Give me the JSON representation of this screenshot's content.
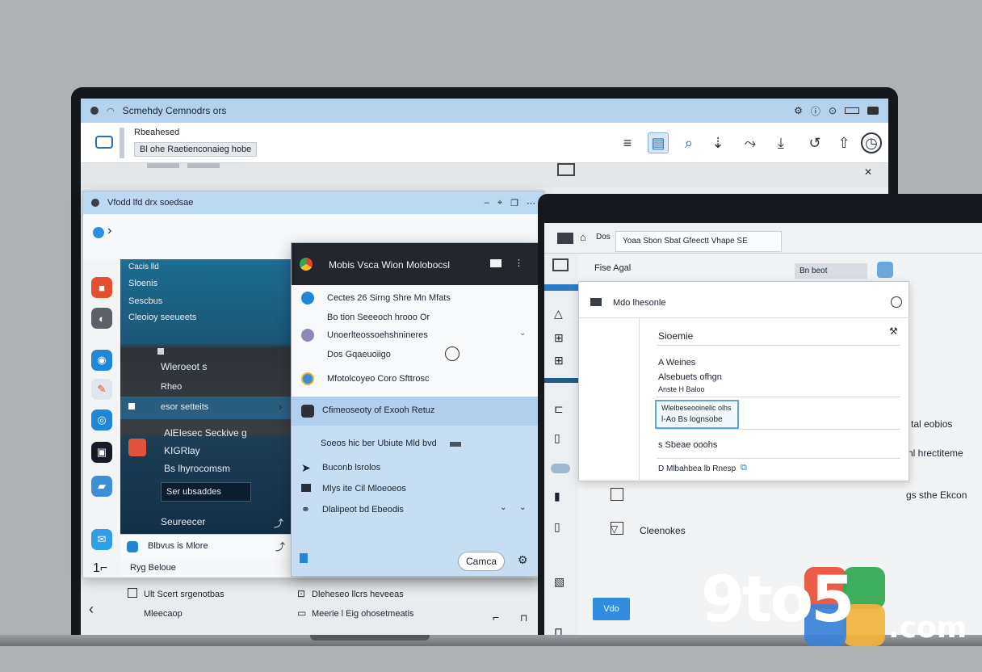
{
  "top_window": {
    "title": "Scmehdy Cemnodrs ors",
    "breadcrumb_top": "Rbeahesed",
    "breadcrumb_bottom": "Bl ohe Raetienconaieg hobe"
  },
  "left_window": {
    "title": "Vfodd lfd drx soedsae",
    "dark_pane": {
      "header": "Cacis lld",
      "items": [
        "Sloenis",
        "Sescbus",
        "Cleoioy seeueets"
      ],
      "middle_label": "Wleroeot s",
      "middle_sub": "Rheo",
      "selected": "esor setteits",
      "block_line1": "AlEIesec Seckive g",
      "block_line2": "KIGRlay",
      "block_line3": "Bs lhyrocomsm",
      "chip": "Ser ubsaddes",
      "footer": "Seureecer"
    },
    "bottom_row": "Blbvus is Mlore",
    "bottom_row2": "Ryg Beloue",
    "below_items": [
      "Ult Scert srgenotbas",
      "Mleecaop"
    ],
    "below_items_right": [
      "Dleheseo llcrs heveeas",
      "Meerie l Eig ohosetmeatis"
    ]
  },
  "popup": {
    "title": "Mobis Vsca Wion Molobocsl",
    "rows": [
      "Cectes 26 Sirng Shre Mn Mfats",
      "Bo tion Seeeoch hrooo Or",
      "Unoerlteossoehshnineres",
      "Dos Gqaeuoiigo",
      "Mfotolcoyeo Coro Sfttrosc"
    ],
    "highlight": "Cfimeoseoty of Exooh Retuz",
    "sub_header": "Soeos hic ber Ubiute Mld bvd",
    "options": [
      "Buconb lsrolos",
      "Mlys ite Cil Mloeoeos",
      "Dlalipeot bd Ebeodis"
    ],
    "button": "Camca"
  },
  "right_window": {
    "tab": "Yoaa Sbon Sbat Gfeectt Vhape SE",
    "address": "Fise Agal",
    "search_chip": "Bn beot",
    "sidebar_label": "Mdo lhesonle",
    "footer_label": "Cleenokes",
    "dialog": {
      "title": "Sioemie",
      "field1": "A Weines",
      "field2": "Alsebuets ofhgn",
      "field3": "Anste H Baloo",
      "box_line1": "Wlelbeseooinelic olhs",
      "box_line2": "l-Ao Bs lognsobe",
      "field4": "s Sbeae ooohs",
      "field5": "D Mlbahbea lb Rnesp"
    },
    "edge_labels": [
      "tal eobios",
      "hl hrectiteme",
      "gs sthe Ekcon"
    ],
    "blue_button": "Vdo"
  },
  "watermark": {
    "brand": "9to5",
    "suffix": ".com",
    "tile_colors": [
      "#e94f35",
      "#2fa84f",
      "#f2b33d",
      "#3b82d8"
    ]
  },
  "colors": {
    "accent": "#2f8ee0",
    "titlebar": "#b5d2ec",
    "dark_pane": "#1b5675",
    "popup_header": "#23272d",
    "highlight": "#b0cfec"
  }
}
